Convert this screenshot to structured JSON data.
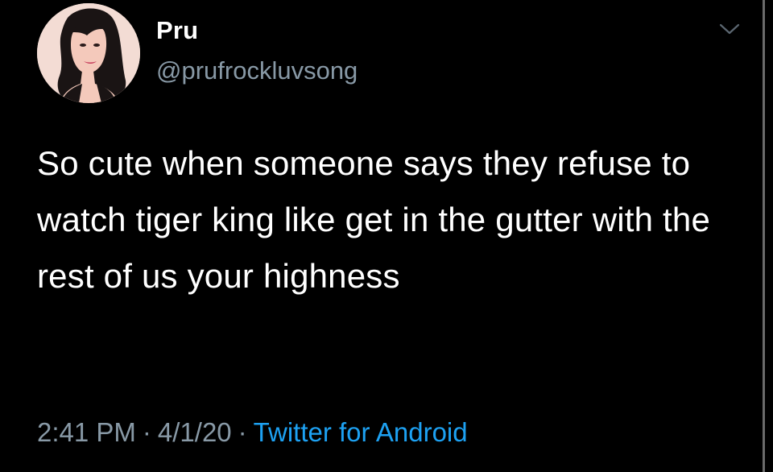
{
  "tweet": {
    "author": {
      "display_name": "Pru",
      "handle": "@prufrockluvsong",
      "avatar_icon": "avatar-portrait-icon"
    },
    "text": "So cute when someone says they refuse to watch tiger king like get in the gutter with the rest of us your highness",
    "time": "2:41 PM",
    "date": "4/1/20",
    "separator": "·",
    "source": "Twitter for Android",
    "menu_icon": "chevron-down-icon"
  },
  "colors": {
    "background": "#000000",
    "text": "#ffffff",
    "secondary": "#8899a6",
    "link": "#1da1f2"
  }
}
